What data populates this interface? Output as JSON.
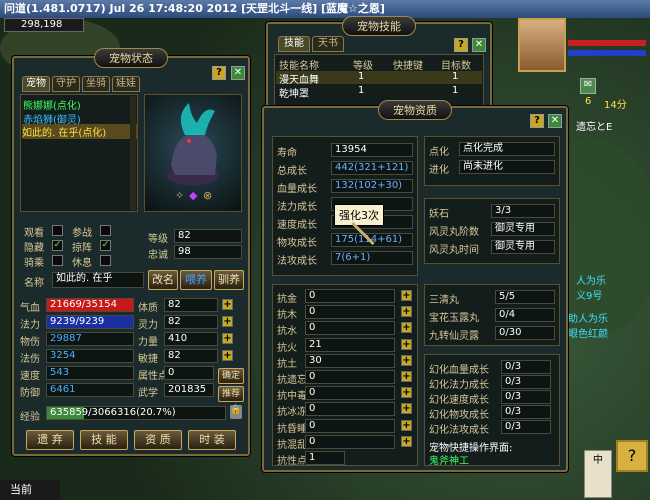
{
  "title": "问道(1.481.0717) Jul 26 17:48:20 2012 [天罡北斗一线] [蓝魔☆之恩]",
  "top_stat": "298,198",
  "pet_state": {
    "title": "宠物状态",
    "tabs": [
      "宠物",
      "守护",
      "坐骑",
      "娃娃"
    ],
    "pets": [
      "熊娜娜(点化)",
      "赤焰狮(御灵)",
      "如此的. 在乎(点化)"
    ],
    "level_label": "等级",
    "level": "82",
    "loyalty_label": "忠诚",
    "loyalty": "98",
    "modes": [
      {
        "label": "观看",
        "checked": false
      },
      {
        "label": "参战",
        "checked": false
      },
      {
        "label": "隐藏",
        "checked": true
      },
      {
        "label": "掠阵",
        "checked": true
      },
      {
        "label": "骑乘",
        "checked": false
      },
      {
        "label": "休息",
        "checked": false
      }
    ],
    "name_label": "名称",
    "name": "如此的. 在乎",
    "rename_btn": "改名",
    "feed_btn": "喂养",
    "tame_btn": "驯养",
    "stats": [
      {
        "label": "气血",
        "value": "21669/35154",
        "label2": "体质",
        "value2": "82"
      },
      {
        "label": "法力",
        "value": "9239/9239",
        "label2": "灵力",
        "value2": "82"
      },
      {
        "label": "物伤",
        "value": "29887",
        "label2": "力量",
        "value2": "410"
      },
      {
        "label": "法伤",
        "value": "3254",
        "label2": "敏捷",
        "value2": "82"
      },
      {
        "label": "速度",
        "value": "543",
        "label2": "属性点",
        "value2": "0"
      },
      {
        "label": "防御",
        "value": "6461",
        "label2": "武学",
        "value2": "201835"
      }
    ],
    "confirm_btn": "确定",
    "recommend_btn": "推荐",
    "exp_label": "经验",
    "exp": "635859/3066316(20.7%)",
    "exp_fraction": 0.207,
    "bottom_btns": [
      "遗 弃",
      "技 能",
      "资 质",
      "时 装"
    ]
  },
  "skills": {
    "title": "宠物技能",
    "tabs": [
      "技能",
      "天书"
    ],
    "headers": [
      "技能名称",
      "等级",
      "快捷键",
      "目标数"
    ],
    "rows": [
      {
        "name": "漫天血舞",
        "level": "1",
        "target": "1"
      },
      {
        "name": "乾坤罩",
        "level": "1",
        "target": "1"
      }
    ]
  },
  "aptitude": {
    "title": "宠物资质",
    "left": [
      {
        "label": "寿命",
        "value": "13954"
      },
      {
        "label": "总成长",
        "value": "442(321+121)"
      },
      {
        "label": "血量成长",
        "value": "132(102+30)"
      },
      {
        "label": "法力成长",
        "value": ""
      },
      {
        "label": "速度成长",
        "value": ""
      },
      {
        "label": "物攻成长",
        "value": "175(114+61)"
      },
      {
        "label": "法攻成长",
        "value": "7(6+1)"
      }
    ],
    "tooltip": "强化3次",
    "right_top": [
      {
        "label": "点化",
        "value": "点化完成"
      },
      {
        "label": "进化",
        "value": "尚未进化"
      }
    ],
    "right_mid": [
      {
        "label": "妖石",
        "value": "3/3"
      },
      {
        "label": "风灵丸阶数",
        "value": "御灵专用"
      },
      {
        "label": "风灵丸时间",
        "value": "御灵专用"
      }
    ],
    "resist": [
      {
        "label": "抗金",
        "value": "0"
      },
      {
        "label": "抗木",
        "value": "0"
      },
      {
        "label": "抗水",
        "value": "0"
      },
      {
        "label": "抗火",
        "value": "21"
      },
      {
        "label": "抗土",
        "value": "30"
      },
      {
        "label": "抗遗忘",
        "value": "0"
      },
      {
        "label": "抗中毒",
        "value": "0"
      },
      {
        "label": "抗冰冻",
        "value": "0"
      },
      {
        "label": "抗昏睡",
        "value": "0"
      },
      {
        "label": "抗混乱",
        "value": "0"
      },
      {
        "label": "抗性点",
        "value": "1"
      }
    ],
    "items": [
      {
        "label": "三清丸",
        "value": "5/5"
      },
      {
        "label": "宝花玉露丸",
        "value": "0/4"
      },
      {
        "label": "九转仙灵露",
        "value": "0/30"
      }
    ],
    "huanhua": [
      {
        "label": "幻化血量成长",
        "value": "0/3"
      },
      {
        "label": "幻化法力成长",
        "value": "0/3"
      },
      {
        "label": "幻化速度成长",
        "value": "0/3"
      },
      {
        "label": "幻化物攻成长",
        "value": "0/3"
      },
      {
        "label": "幻化法攻成长",
        "value": "0/3"
      }
    ],
    "shortcut_label": "宠物快捷操作界面:",
    "shortcut_value": "鬼斧神工"
  },
  "side": {
    "badge1": "6",
    "badge2": "14分",
    "texts": [
      "遗忘とE",
      "人为乐",
      "义9号",
      "助人为乐",
      "眼色红颜"
    ],
    "bottom_left": "当前"
  }
}
